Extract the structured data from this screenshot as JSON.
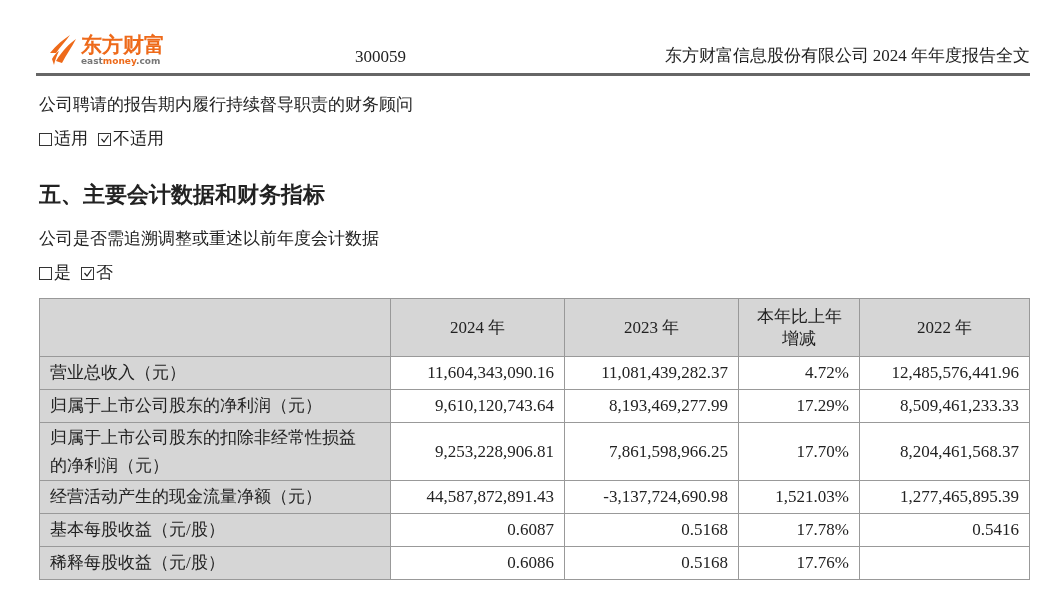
{
  "header": {
    "logo": {
      "name": "东方财富",
      "domain_parts": [
        {
          "text": "east",
          "highlight": false
        },
        {
          "text": "money",
          "highlight": true
        },
        {
          "text": ".com",
          "highlight": false
        }
      ]
    },
    "code": "300059",
    "title": "东方财富信息股份有限公司 2024 年年度报告全文"
  },
  "sections": [
    {
      "kind": "question",
      "text": "公司聘请的报告期内履行持续督导职责的财务顾问",
      "options": [
        {
          "label": "适用",
          "checked": false
        },
        {
          "label": "不适用",
          "checked": true
        }
      ]
    },
    {
      "kind": "heading",
      "text": "五、主要会计数据和财务指标"
    },
    {
      "kind": "question",
      "text": "公司是否需追溯调整或重述以前年度会计数据",
      "options": [
        {
          "label": "是",
          "checked": false
        },
        {
          "label": "否",
          "checked": true
        }
      ]
    }
  ],
  "table": {
    "columns": [
      "",
      "2024 年",
      "2023 年",
      "本年比上年增减",
      "2022 年"
    ],
    "rows": [
      {
        "cells": [
          "营业总收入（元）",
          "11,604,343,090.16",
          "11,081,439,282.37",
          "4.72%",
          "12,485,576,441.96"
        ]
      },
      {
        "cells": [
          "归属于上市公司股东的净利润（元）",
          "9,610,120,743.64",
          "8,193,469,277.99",
          "17.29%",
          "8,509,461,233.33"
        ]
      },
      {
        "cells": [
          "归属于上市公司股东的扣除非经常性损益的净利润（元）",
          "9,253,228,906.81",
          "7,861,598,966.25",
          "17.70%",
          "8,204,461,568.37"
        ]
      },
      {
        "cells": [
          "经营活动产生的现金流量净额（元）",
          "44,587,872,891.43",
          "-3,137,724,690.98",
          "1,521.03%",
          "1,277,465,895.39"
        ]
      },
      {
        "cells": [
          "基本每股收益（元/股）",
          "0.6087",
          "0.5168",
          "17.78%",
          "0.5416"
        ]
      },
      {
        "cells": [
          "稀释每股收益（元/股）",
          "0.6086",
          "0.5168",
          "17.76%",
          ""
        ]
      }
    ]
  }
}
